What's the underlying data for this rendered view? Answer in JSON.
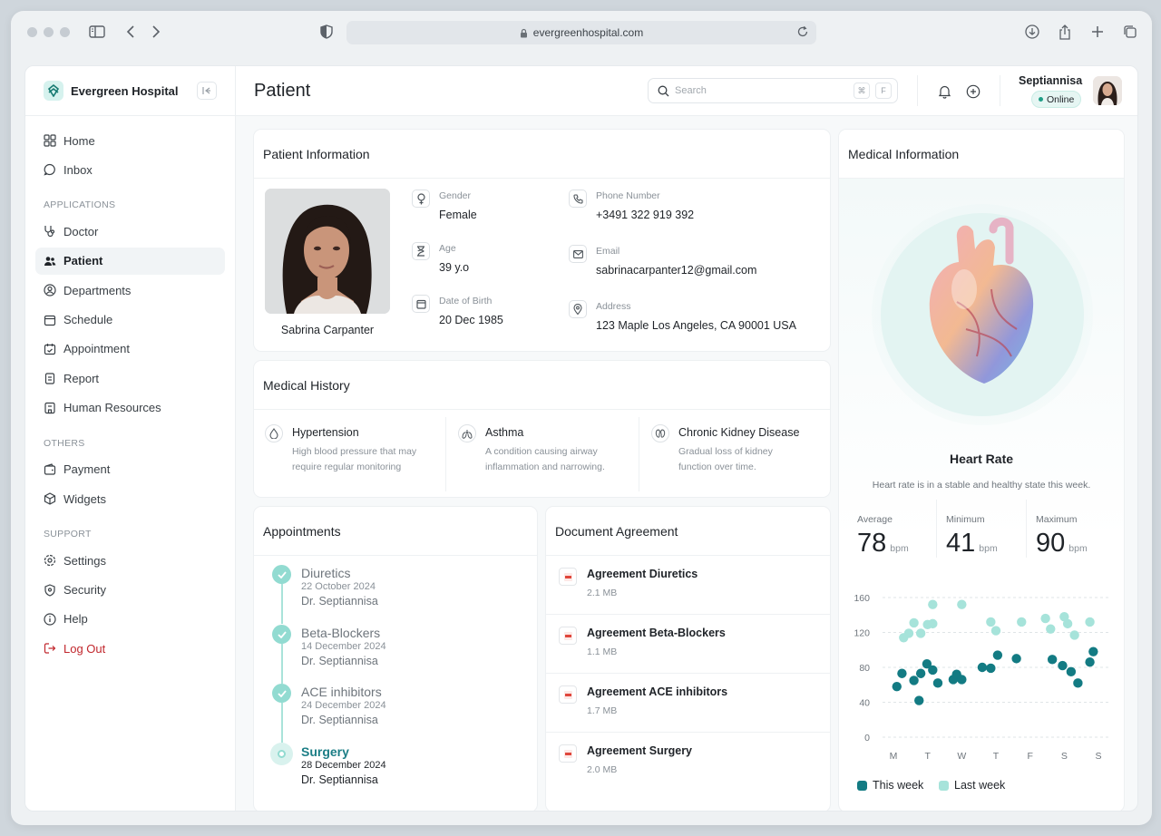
{
  "browser": {
    "url": "evergreenhospital.com"
  },
  "sidebar": {
    "brand": "Evergreen Hospital",
    "top_items": [
      {
        "label": "Home",
        "icon": "grid-icon"
      },
      {
        "label": "Inbox",
        "icon": "chat-icon"
      }
    ],
    "applications_label": "APPLICATIONS",
    "app_items": [
      {
        "label": "Doctor",
        "icon": "stethoscope-icon"
      },
      {
        "label": "Patient",
        "icon": "users-icon",
        "active": true
      },
      {
        "label": "Departments",
        "icon": "user-circle-icon"
      },
      {
        "label": "Schedule",
        "icon": "calendar-icon"
      },
      {
        "label": "Appointment",
        "icon": "calendar-check-icon"
      },
      {
        "label": "Report",
        "icon": "clipboard-icon"
      },
      {
        "label": "Human Resources",
        "icon": "building-icon"
      }
    ],
    "others_label": "OTHERS",
    "other_items": [
      {
        "label": "Payment",
        "icon": "wallet-icon"
      },
      {
        "label": "Widgets",
        "icon": "cube-icon"
      }
    ],
    "support_label": "SUPPORT",
    "support_items": [
      {
        "label": "Settings",
        "icon": "gear-icon"
      },
      {
        "label": "Security",
        "icon": "shield-icon"
      },
      {
        "label": "Help",
        "icon": "info-icon"
      },
      {
        "label": "Log Out",
        "icon": "logout-icon"
      }
    ]
  },
  "header": {
    "title": "Patient",
    "search_placeholder": "Search",
    "shortcut_1": "⌘",
    "shortcut_2": "F",
    "user_name": "Septiannisa",
    "status": "Online"
  },
  "patient_info": {
    "title": "Patient Information",
    "name": "Sabrina Carpanter",
    "gender_label": "Gender",
    "gender": "Female",
    "age_label": "Age",
    "age": "39 y.o",
    "dob_label": "Date of Birth",
    "dob": "20 Dec 1985",
    "phone_label": "Phone Number",
    "phone": "+3491 322 919 392",
    "email_label": "Email",
    "email": "sabrinacarpanter12@gmail.com",
    "address_label": "Address",
    "address": "123 Maple Los Angeles, CA 90001 USA"
  },
  "medical_history": {
    "title": "Medical History",
    "items": [
      {
        "name": "Hypertension",
        "desc1": "High blood pressure that may",
        "desc2": "require regular monitoring"
      },
      {
        "name": "Asthma",
        "desc1": "A condition causing airway",
        "desc2": "inflammation and narrowing."
      },
      {
        "name": "Chronic Kidney Disease",
        "desc1": "Gradual loss of kidney",
        "desc2": "function over time."
      }
    ]
  },
  "appointments": {
    "title": "Appointments",
    "items": [
      {
        "name": "Diuretics",
        "date": "22 October 2024",
        "doctor": "Dr. Septiannisa",
        "done": true
      },
      {
        "name": "Beta-Blockers",
        "date": "14 December 2024",
        "doctor": "Dr. Septiannisa",
        "done": true
      },
      {
        "name": "ACE inhibitors",
        "date": "24 December 2024",
        "doctor": "Dr. Septiannisa",
        "done": true
      },
      {
        "name": "Surgery",
        "date": "28 December 2024",
        "doctor": "Dr. Septiannisa",
        "done": false
      }
    ]
  },
  "documents": {
    "title": "Document Agreement",
    "items": [
      {
        "name": "Agreement Diuretics",
        "size": "2.1 MB"
      },
      {
        "name": "Agreement Beta-Blockers",
        "size": "1.1 MB"
      },
      {
        "name": "Agreement ACE inhibitors",
        "size": "1.7 MB"
      },
      {
        "name": "Agreement Surgery",
        "size": "2.0 MB"
      }
    ]
  },
  "medical_info": {
    "title": "Medical Information",
    "heart_title": "Heart Rate",
    "heart_sub": "Heart rate is in a stable and healthy state this week.",
    "average_label": "Average",
    "average": "78",
    "minimum_label": "Minimum",
    "minimum": "41",
    "maximum_label": "Maximum",
    "maximum": "90",
    "unit": "bpm"
  },
  "colors": {
    "accent": "#1c7e86",
    "this_week": "#137b83",
    "last_week": "#a6e3da",
    "logout": "#c1272d"
  },
  "chart_data": {
    "type": "scatter",
    "categories": [
      "M",
      "T",
      "W",
      "T",
      "F",
      "S",
      "S"
    ],
    "ylim": [
      0,
      160
    ],
    "yticks": [
      0,
      40,
      80,
      120,
      160
    ],
    "legend": "bottom",
    "series": [
      {
        "name": "This week",
        "points": [
          [
            0.1,
            58
          ],
          [
            0.25,
            73
          ],
          [
            0.6,
            65
          ],
          [
            0.75,
            42
          ],
          [
            0.8,
            73
          ],
          [
            0.98,
            84
          ],
          [
            1.15,
            77
          ],
          [
            1.3,
            62
          ],
          [
            1.75,
            66
          ],
          [
            1.85,
            72
          ],
          [
            2.0,
            66
          ],
          [
            2.6,
            80
          ],
          [
            2.85,
            79
          ],
          [
            3.05,
            94
          ],
          [
            3.6,
            90
          ],
          [
            4.65,
            89
          ],
          [
            4.95,
            82
          ],
          [
            5.2,
            75
          ],
          [
            5.4,
            62
          ],
          [
            5.75,
            86
          ],
          [
            5.85,
            98
          ]
        ]
      },
      {
        "name": "Last week",
        "points": [
          [
            0.3,
            114
          ],
          [
            0.45,
            119
          ],
          [
            0.6,
            131
          ],
          [
            0.8,
            119
          ],
          [
            1.0,
            129
          ],
          [
            1.15,
            130
          ],
          [
            1.15,
            152
          ],
          [
            2.0,
            152
          ],
          [
            2.85,
            132
          ],
          [
            3.0,
            122
          ],
          [
            3.75,
            132
          ],
          [
            4.45,
            136
          ],
          [
            4.6,
            124
          ],
          [
            5.0,
            138
          ],
          [
            5.1,
            130
          ],
          [
            5.3,
            117
          ],
          [
            5.75,
            132
          ]
        ]
      }
    ]
  }
}
